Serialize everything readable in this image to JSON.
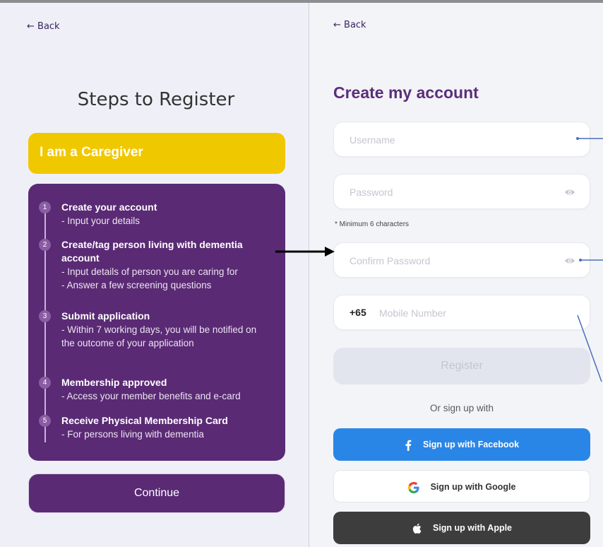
{
  "left_panel": {
    "back_label": "← Back",
    "title": "Steps to Register",
    "role_banner": "I am a Caregiver",
    "steps": [
      {
        "number": "1",
        "title": "Create your account",
        "lines": [
          "- Input your details"
        ]
      },
      {
        "number": "2",
        "title": "Create/tag person living with dementia account",
        "lines": [
          "- Input details of person you are caring for",
          "- Answer a few screening questions"
        ]
      },
      {
        "number": "3",
        "title": "Submit application",
        "lines": [
          "- Within 7 working days, you will be notified on the outcome of your application"
        ]
      },
      {
        "number": "4",
        "title": "Membership approved",
        "lines": [
          "- Access your member benefits and e-card"
        ]
      },
      {
        "number": "5",
        "title": "Receive Physical Membership Card",
        "lines": [
          "- For persons living with dementia"
        ]
      }
    ],
    "continue_label": "Continue"
  },
  "right_panel": {
    "back_label": "← Back",
    "title": "Create my account",
    "username_placeholder": "Username",
    "password_placeholder": "Password",
    "password_hint": "* Minimum 6 characters",
    "confirm_password_placeholder": "Confirm Password",
    "country_code": "+65",
    "mobile_placeholder": "Mobile Number",
    "register_label": "Register",
    "or_text": "Or sign up with",
    "social": {
      "facebook_label": "Sign up with Facebook",
      "google_label": "Sign up with Google",
      "apple_label": "Sign up with Apple"
    }
  },
  "colors": {
    "brand_purple": "#5a2a74",
    "caregiver_yellow": "#f0c800",
    "facebook_blue": "#2a86e6",
    "apple_dark": "#3d3d3d"
  }
}
